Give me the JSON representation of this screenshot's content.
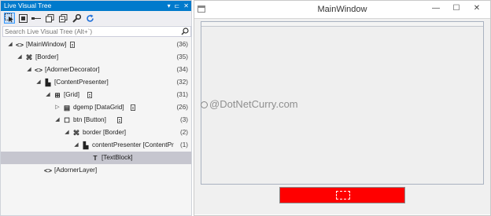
{
  "panel": {
    "title": "Live Visual Tree",
    "title_buttons": [
      "▾",
      "⊏",
      "✕"
    ],
    "search": {
      "placeholder": "Search Live Visual Tree (Alt+`)",
      "value": ""
    },
    "toolbar_icons": [
      "select-element-icon",
      "display-adorners-icon",
      "track-focus-icon",
      "collapse-icon",
      "expand-icon",
      "properties-icon",
      "refresh-icon"
    ],
    "tree": [
      {
        "label": "[MainWindow]",
        "icon": "<>",
        "arrow": "◢",
        "binding": true,
        "count": "(36)",
        "depth": 0
      },
      {
        "label": "[Border]",
        "icon": "⌘",
        "arrow": "◢",
        "binding": false,
        "count": "(35)",
        "depth": 1
      },
      {
        "label": "[AdornerDecorator]",
        "icon": "<>",
        "arrow": "◢",
        "binding": false,
        "count": "(34)",
        "depth": 2
      },
      {
        "label": "[ContentPresenter]",
        "icon": "▙",
        "arrow": "◢",
        "binding": false,
        "count": "(32)",
        "depth": 3
      },
      {
        "label": "[Grid]",
        "icon": "⊞",
        "arrow": "◢",
        "binding": true,
        "count": "(31)",
        "depth": 4
      },
      {
        "label": "dgemp [DataGrid]",
        "icon": "▤",
        "arrow": "▷",
        "binding": true,
        "count": "(26)",
        "depth": 5
      },
      {
        "label": "btn [Button]",
        "icon": "☐",
        "arrow": "◢",
        "binding": true,
        "count": "(3)",
        "depth": 5
      },
      {
        "label": "border [Border]",
        "icon": "⌘",
        "arrow": "◢",
        "binding": false,
        "count": "(2)",
        "depth": 6
      },
      {
        "label": "contentPresenter [ContentPr",
        "icon": "▙",
        "arrow": "◢",
        "binding": false,
        "count": "(1)",
        "depth": 7
      },
      {
        "label": "[TextBlock]",
        "icon": "T",
        "arrow": "",
        "binding": false,
        "count": "",
        "depth": 8,
        "selected": true
      },
      {
        "label": "[AdornerLayer]",
        "icon": "<>",
        "arrow": "",
        "binding": false,
        "count": "",
        "depth": 3
      }
    ]
  },
  "window": {
    "title": "MainWindow",
    "controls": {
      "minimize": "—",
      "maximize": "☐",
      "close": "✕"
    },
    "watermark": "@DotNetCurry.com",
    "button_text": "",
    "button_color": "#ff0000"
  },
  "colors": {
    "accent": "#007acc",
    "selection": "#c6c6cf",
    "button": "#ff0000"
  }
}
